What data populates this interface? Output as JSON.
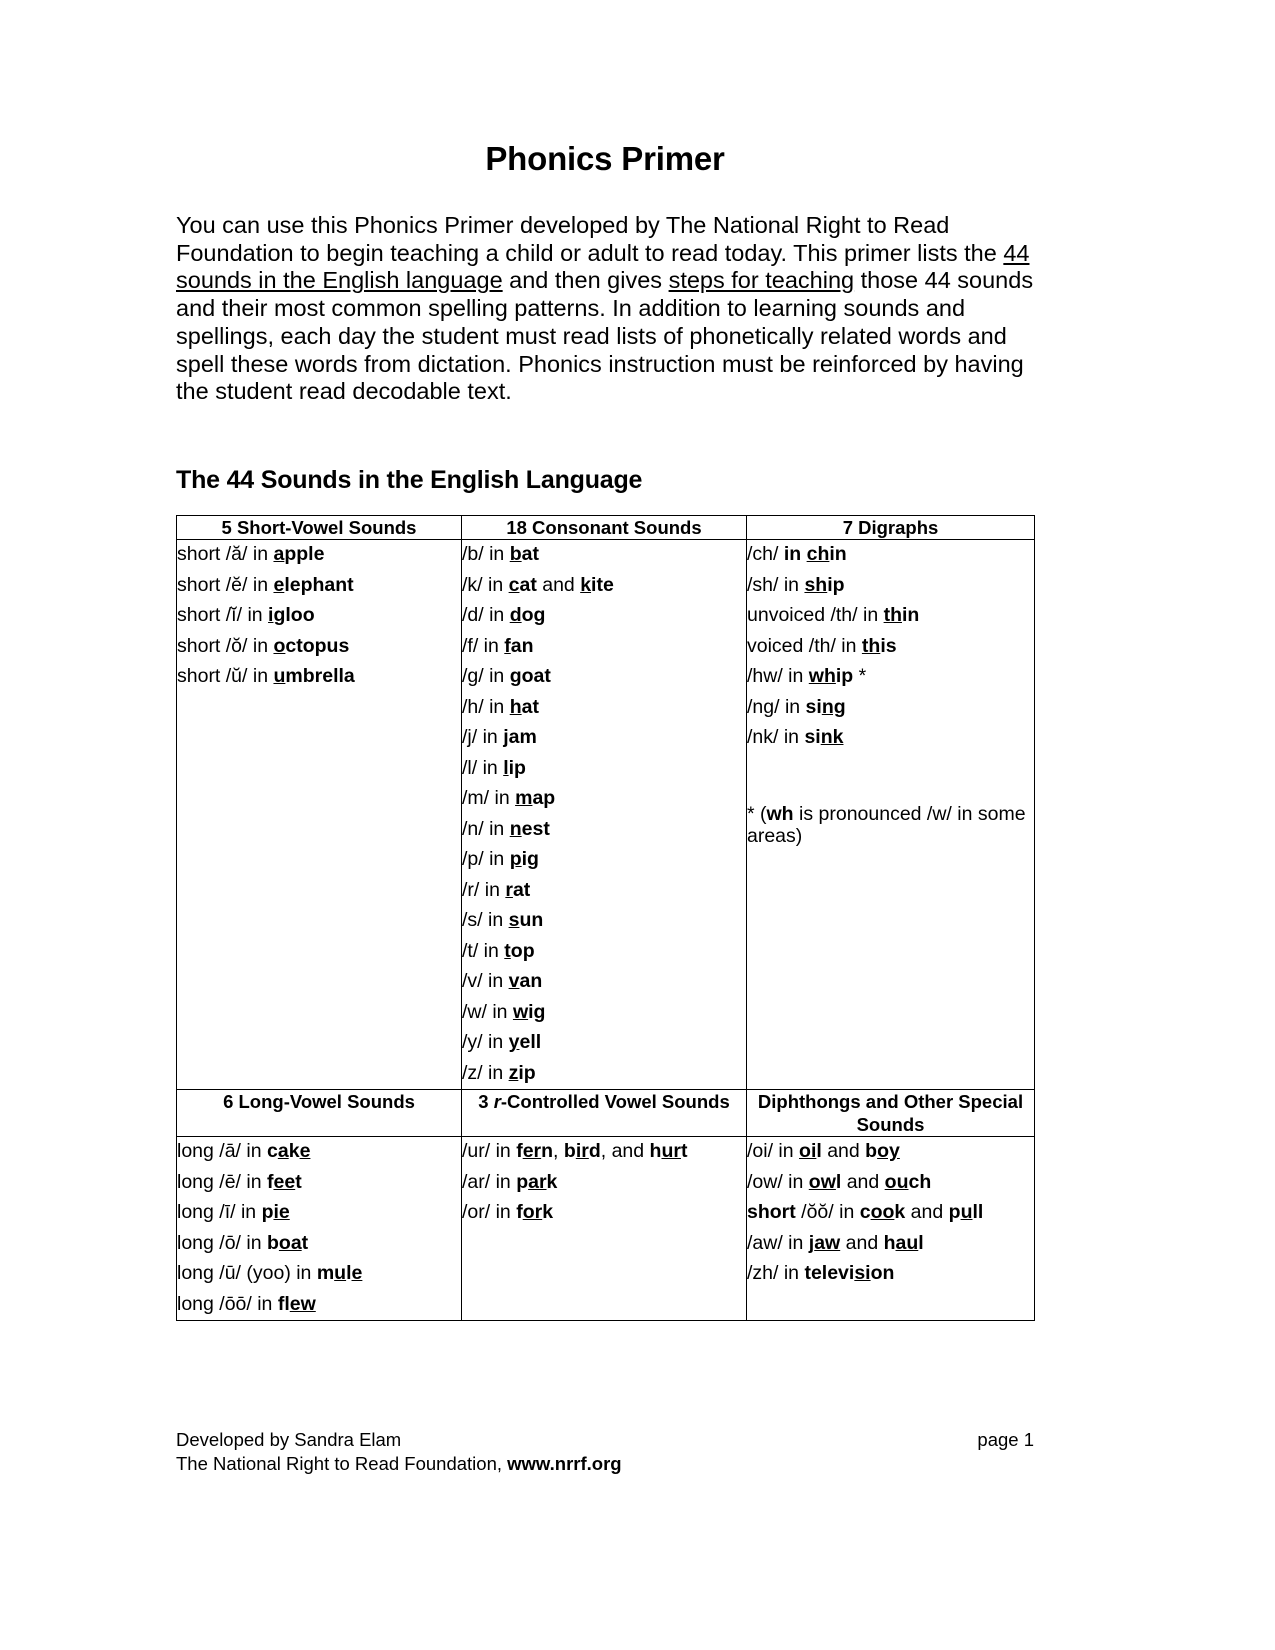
{
  "document": {
    "title": "Phonics Primer",
    "intro": {
      "part1": "You can use this Phonics Primer developed by The National Right to Read Foundation to begin teaching a child or adult to read today. This primer lists the ",
      "link1": "44 sounds in the English language",
      "part2": " and then gives ",
      "link2": "steps for teaching",
      "part3": " those 44 sounds and their most common spelling patterns. In addition to learning sounds and spellings, each day the student must read lists of phonetically related words and spell these words from dictation. Phonics instruction must be reinforced by having the student read decodable text."
    },
    "section_title": "The 44 Sounds in the English Language"
  },
  "table": {
    "headers_row1": {
      "col1": "5 Short-Vowel Sounds",
      "col2": "18 Consonant Sounds",
      "col3": "7 Digraphs"
    },
    "headers_row2": {
      "col1": "6 Long-Vowel Sounds",
      "col2_pre": "3 ",
      "col2_ital": "r",
      "col2_post": "-Controlled Vowel Sounds",
      "col3": "Diphthongs and Other Special Sounds"
    },
    "short_vowels": [
      "short /ă/ in apple",
      "short /ĕ/ in elephant",
      "short /ĭ/ in igloo",
      "short /ŏ/ in octopus",
      "short /ŭ/ in umbrella"
    ],
    "consonants": [
      "/b/ in bat",
      "/k/ in cat and kite",
      "/d/ in dog",
      "/f/ in fan",
      "/g/ in goat",
      "/h/ in hat",
      "/j/ in jam",
      "/l/ in lip",
      "/m/ in map",
      "/n/ in nest",
      "/p/ in pig",
      "/r/ in rat",
      "/s/ in sun",
      "/t/ in top",
      "/v/ in van",
      "/w/ in wig",
      "/y/ in yell",
      "/z/ in zip"
    ],
    "digraphs": [
      "/ch/ in chin",
      "/sh/ in ship",
      "unvoiced /th/ in thin",
      "voiced /th/ in this",
      "/hw/ in whip *",
      "/ng/ in sing",
      "/nk/ in sink"
    ],
    "digraph_note": "* (wh is pronounced /w/ in some areas)",
    "long_vowels": [
      "long /ā/ in cake",
      "long /ē/ in feet",
      "long /ī/ in pie",
      "long /ō/ in boat",
      "long /ū/ (yoo) in mule",
      "long /ōō/ in flew"
    ],
    "r_controlled": [
      "/ur/ in fern, bird, and hurt",
      "/ar/ in park",
      "/or/ in fork"
    ],
    "diphthongs": [
      "/oi/ in oil and boy",
      "/ow/ in owl and ouch",
      "short /ŏŏ/ in cook and pull",
      "/aw/ in jaw and haul",
      "/zh/ in television"
    ]
  },
  "footer": {
    "line1": "Developed by Sandra Elam",
    "line2_pre": "The National Right to Read Foundation, ",
    "line2_bold": "www.nrrf.org",
    "page": "page 1"
  }
}
